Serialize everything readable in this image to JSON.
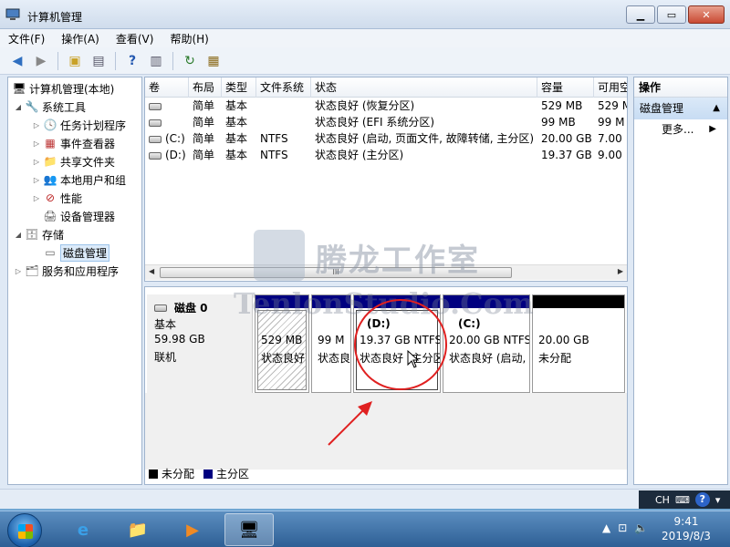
{
  "window": {
    "title": "计算机管理"
  },
  "menu": [
    "文件(F)",
    "操作(A)",
    "查看(V)",
    "帮助(H)"
  ],
  "tree": {
    "root": "计算机管理(本地)",
    "system_tools": "系统工具",
    "task_scheduler": "任务计划程序",
    "event_viewer": "事件查看器",
    "shared_folders": "共享文件夹",
    "local_users": "本地用户和组",
    "performance": "性能",
    "device_manager": "设备管理器",
    "storage": "存储",
    "disk_management": "磁盘管理",
    "services_apps": "服务和应用程序"
  },
  "volume_table": {
    "headers": [
      "卷",
      "布局",
      "类型",
      "文件系统",
      "状态",
      "容量",
      "可用空"
    ],
    "rows": [
      {
        "vol": "",
        "layout": "简单",
        "type": "基本",
        "fs": "",
        "status": "状态良好 (恢复分区)",
        "capacity": "529 MB",
        "free": "529 M"
      },
      {
        "vol": "",
        "layout": "简单",
        "type": "基本",
        "fs": "",
        "status": "状态良好 (EFI 系统分区)",
        "capacity": "99 MB",
        "free": "99 M"
      },
      {
        "vol": "(C:)",
        "layout": "简单",
        "type": "基本",
        "fs": "NTFS",
        "status": "状态良好 (启动, 页面文件, 故障转储, 主分区)",
        "capacity": "20.00 GB",
        "free": "7.00"
      },
      {
        "vol": "(D:)",
        "layout": "简单",
        "type": "基本",
        "fs": "NTFS",
        "status": "状态良好 (主分区)",
        "capacity": "19.37 GB",
        "free": "9.00"
      }
    ],
    "scroll_grip": "III"
  },
  "disk": {
    "name": "磁盘 0",
    "type": "基本",
    "size": "59.98 GB",
    "status": "联机",
    "partitions": [
      {
        "line1": "529 MB",
        "line2": "状态良好"
      },
      {
        "line1": "99 M",
        "line2": "状态良"
      },
      {
        "title": "(D:)",
        "line1": "19.37 GB NTFS",
        "line2": "状态良好 (主分区"
      },
      {
        "title": "(C:)",
        "line1": "20.00 GB NTFS",
        "line2": "状态良好 (启动,"
      },
      {
        "line1": "20.00 GB",
        "line2": "未分配"
      }
    ]
  },
  "legend": {
    "unallocated": "未分配",
    "primary": "主分区"
  },
  "actions": {
    "header": "操作",
    "section": "磁盘管理",
    "more": "更多..."
  },
  "watermark": {
    "cn": "腾龙工作室",
    "en": "TenlonStudio.Com"
  },
  "langbar": {
    "lang": "CH",
    "help": "?"
  },
  "clock": {
    "time": "9:41",
    "date": "2019/8/3"
  },
  "colors": {
    "primary_partition": "#000080",
    "unallocated": "#000000",
    "annotation": "#e02020"
  }
}
